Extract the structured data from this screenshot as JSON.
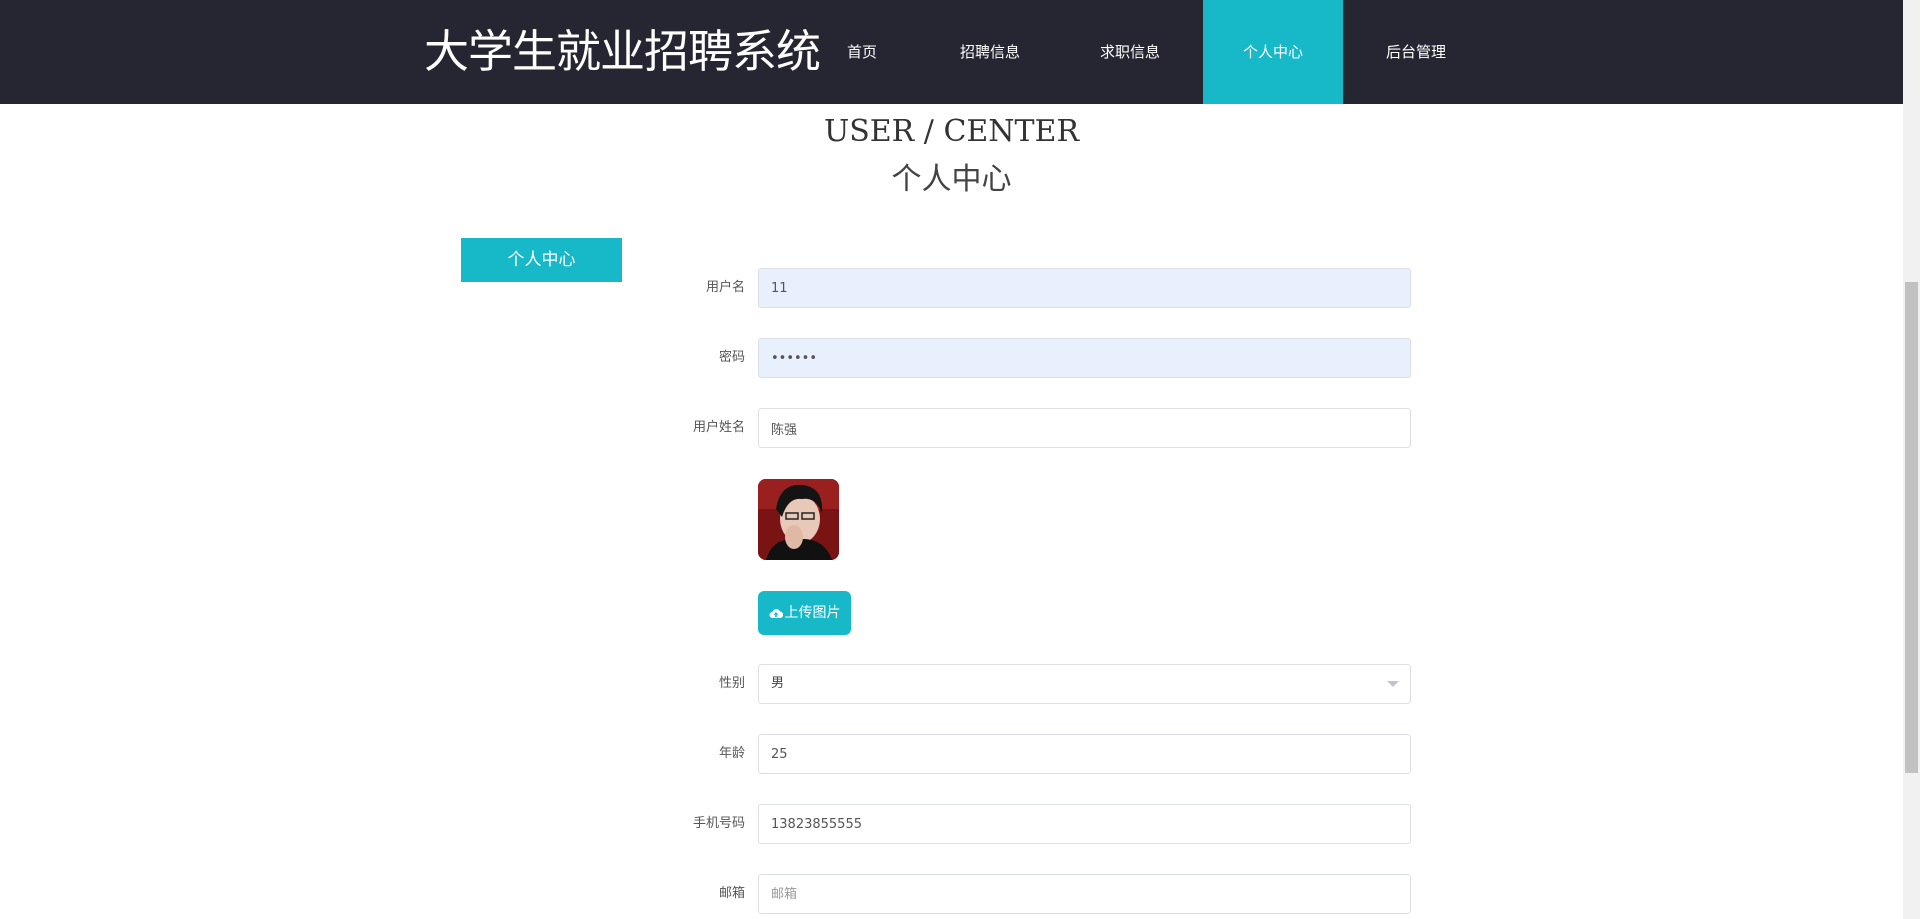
{
  "header": {
    "brand": "大学生就业招聘系统",
    "nav": [
      {
        "label": "首页"
      },
      {
        "label": "招聘信息"
      },
      {
        "label": "求职信息"
      },
      {
        "label": "个人中心",
        "active": true
      },
      {
        "label": "后台管理"
      }
    ]
  },
  "page": {
    "title_en": "USER / CENTER",
    "title_cn": "个人中心"
  },
  "sidebar": {
    "tab_label": "个人中心"
  },
  "form": {
    "username": {
      "label": "用户名",
      "value": "11"
    },
    "password": {
      "label": "密码",
      "value": "••••••"
    },
    "fullname": {
      "label": "用户姓名",
      "value": "陈强"
    },
    "avatar_icon": "avatar-photo",
    "upload": {
      "label": "上传图片",
      "icon": "cloud-upload-icon"
    },
    "gender": {
      "label": "性别",
      "value": "男"
    },
    "age": {
      "label": "年龄",
      "value": "25"
    },
    "phone": {
      "label": "手机号码",
      "value": "13823855555"
    },
    "email": {
      "label": "邮箱",
      "value": "",
      "placeholder": "邮箱"
    }
  },
  "colors": {
    "header_bg": "#252631",
    "accent": "#17b9c8",
    "autofill_bg": "#e8f0fe"
  }
}
